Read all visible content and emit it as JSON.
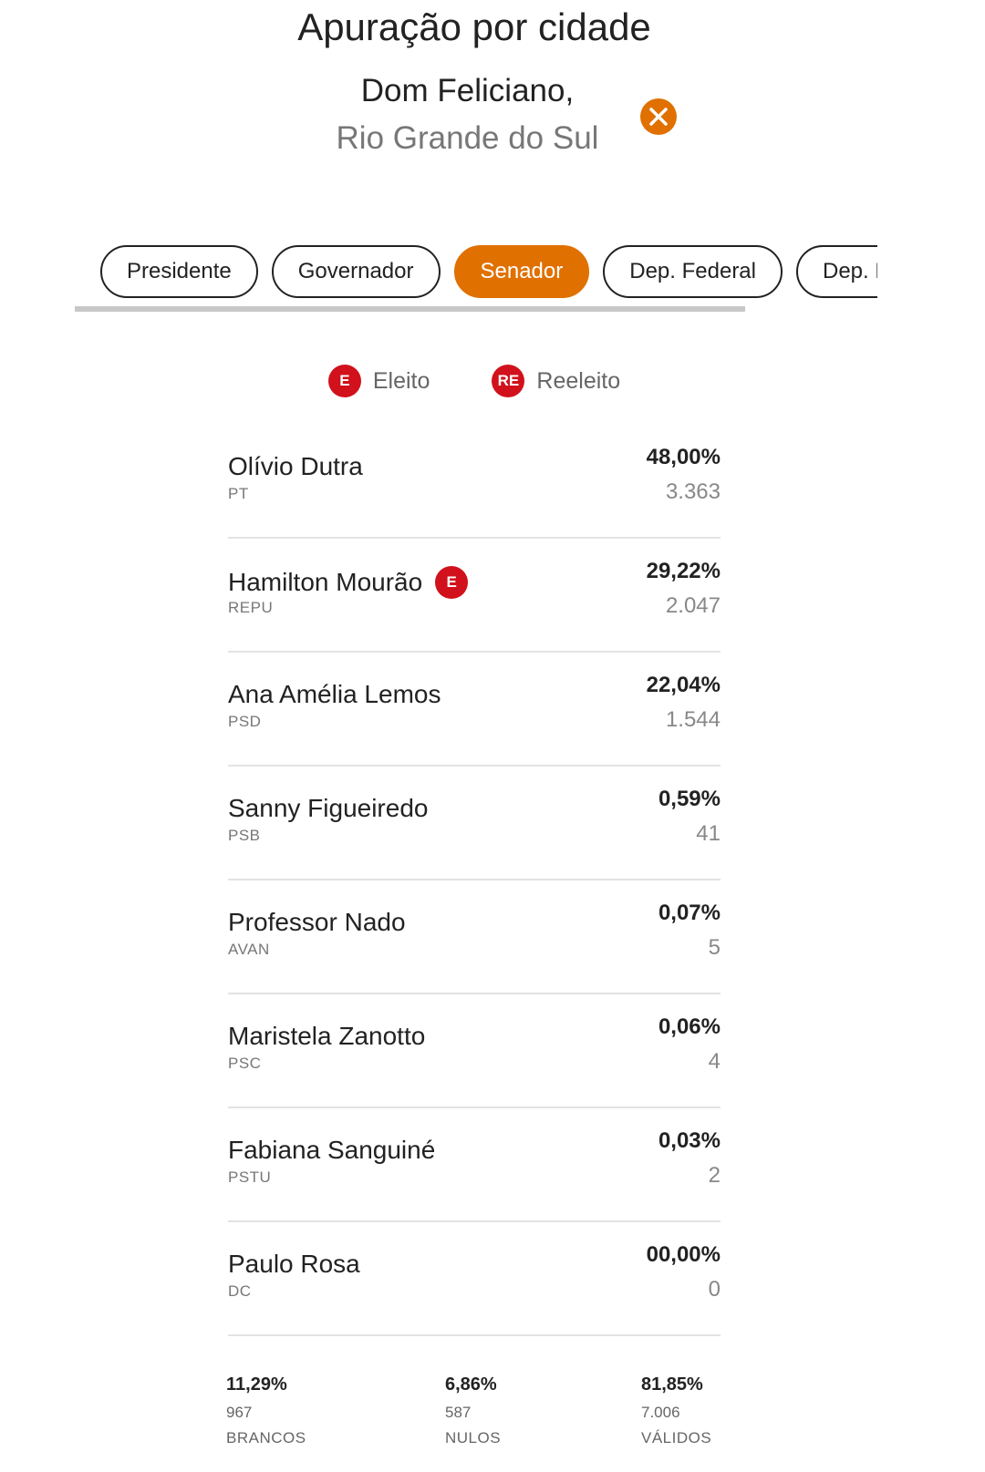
{
  "header": {
    "title": "Apuração por cidade",
    "city": "Dom Feliciano,",
    "state": "Rio Grande do Sul"
  },
  "close_icon": "close-x-icon",
  "tabs": [
    {
      "label": "Presidente",
      "active": false
    },
    {
      "label": "Governador",
      "active": false
    },
    {
      "label": "Senador",
      "active": true
    },
    {
      "label": "Dep. Federal",
      "active": false
    },
    {
      "label": "Dep. Estadual",
      "active": false
    }
  ],
  "legend": {
    "elected_badge": "E",
    "elected_label": "Eleito",
    "reelected_badge": "RE",
    "reelected_label": "Reeleito"
  },
  "candidates": [
    {
      "name": "Olívio Dutra",
      "party": "PT",
      "percent": "48,00%",
      "votes": "3.363",
      "badge": ""
    },
    {
      "name": "Hamilton Mourão",
      "party": "REPU",
      "percent": "29,22%",
      "votes": "2.047",
      "badge": "E"
    },
    {
      "name": "Ana Amélia Lemos",
      "party": "PSD",
      "percent": "22,04%",
      "votes": "1.544",
      "badge": ""
    },
    {
      "name": "Sanny Figueiredo",
      "party": "PSB",
      "percent": "0,59%",
      "votes": "41",
      "badge": ""
    },
    {
      "name": "Professor Nado",
      "party": "AVAN",
      "percent": "0,07%",
      "votes": "5",
      "badge": ""
    },
    {
      "name": "Maristela Zanotto",
      "party": "PSC",
      "percent": "0,06%",
      "votes": "4",
      "badge": ""
    },
    {
      "name": "Fabiana Sanguiné",
      "party": "PSTU",
      "percent": "0,03%",
      "votes": "2",
      "badge": ""
    },
    {
      "name": "Paulo Rosa",
      "party": "DC",
      "percent": "00,00%",
      "votes": "0",
      "badge": ""
    }
  ],
  "summary": {
    "blank": {
      "percent": "11,29%",
      "count": "967",
      "label": "BRANCOS"
    },
    "null": {
      "percent": "6,86%",
      "count": "587",
      "label": "NULOS"
    },
    "valid": {
      "percent": "81,85%",
      "count": "7.006",
      "label": "VÁLIDOS"
    }
  },
  "colors": {
    "accent": "#e07000",
    "elected_badge": "#d1111c"
  }
}
